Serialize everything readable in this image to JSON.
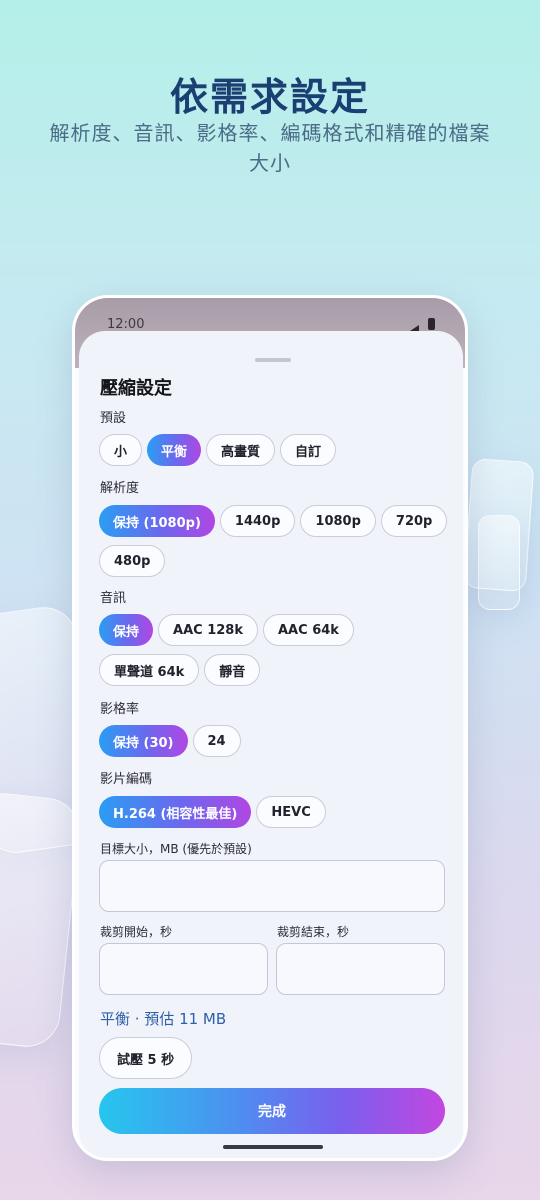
{
  "hero": {
    "title": "依需求設定",
    "subtitle": "解析度、音訊、影格率、編碼格式和精確的檔案大小"
  },
  "status_bar": {
    "time": "12:00"
  },
  "sheet": {
    "title": "壓縮設定",
    "preset": {
      "label": "預設",
      "options": [
        "小",
        "平衡",
        "高畫質",
        "自訂"
      ],
      "selected": "平衡"
    },
    "resolution": {
      "label": "解析度",
      "options": [
        "保持 (1080p)",
        "1440p",
        "1080p",
        "720p",
        "480p"
      ],
      "selected": "保持 (1080p)"
    },
    "audio": {
      "label": "音訊",
      "options": [
        "保持",
        "AAC 128k",
        "AAC 64k",
        "單聲道 64k",
        "靜音"
      ],
      "selected": "保持"
    },
    "frame_rate": {
      "label": "影格率",
      "options": [
        "保持 (30)",
        "24"
      ],
      "selected": "保持 (30)"
    },
    "video_codec": {
      "label": "影片編碼",
      "options": [
        "H.264 (相容性最佳)",
        "HEVC"
      ],
      "selected": "H.264 (相容性最佳)"
    },
    "target_size": {
      "label": "目標大小，MB (優先於預設)",
      "value": ""
    },
    "trim_start": {
      "label": "裁剪開始，秒",
      "value": ""
    },
    "trim_end": {
      "label": "裁剪結束，秒",
      "value": ""
    },
    "summary": "平衡 · 預估 11 MB",
    "trial_button": "試壓 5 秒",
    "done_button": "完成"
  },
  "colors": {
    "accent_gradient_start": "#2a9df2",
    "accent_gradient_end": "#b046e3",
    "title_color": "#1b3f73",
    "summary_color": "#2f5fa6"
  }
}
